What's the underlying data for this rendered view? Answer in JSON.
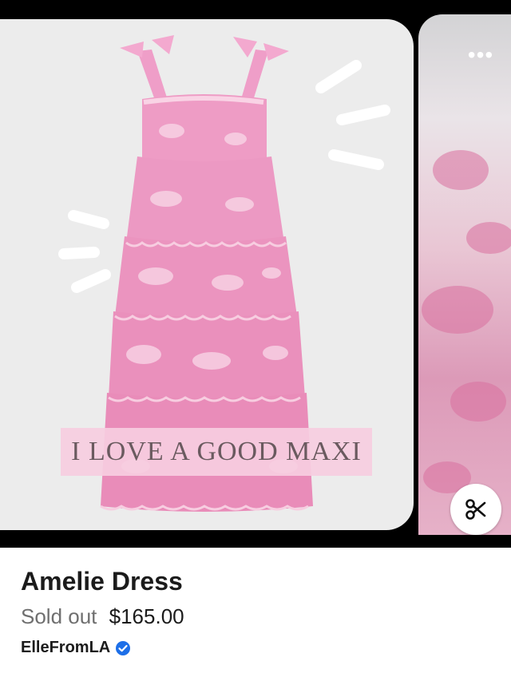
{
  "pin": {
    "overlay_caption": "I LOVE A GOOD MAXI",
    "more_icon": "more-dots-icon",
    "scissors_icon": "scissors-icon"
  },
  "product": {
    "title": "Amelie Dress",
    "status": "Sold out",
    "price": "$165.00"
  },
  "seller": {
    "name": "ElleFromLA",
    "verified_icon": "verified-check-icon"
  },
  "colors": {
    "dress_pink": "#ec9cc6",
    "dress_light": "#f6c8dc",
    "card_background": "#ececec",
    "verified_blue": "#1d6fe8"
  }
}
